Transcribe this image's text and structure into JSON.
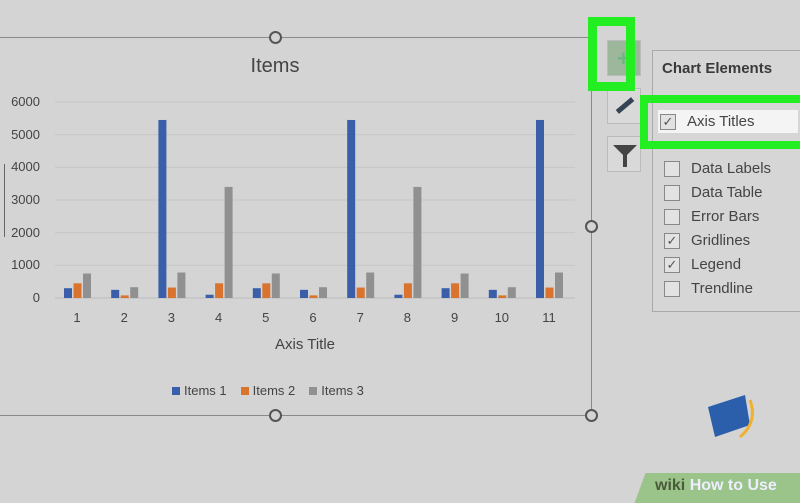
{
  "chart_data": {
    "type": "bar",
    "title": "Items",
    "xlabel": "Axis Title",
    "ylabel": "",
    "categories": [
      "1",
      "2",
      "3",
      "4",
      "5",
      "6",
      "7",
      "8",
      "9",
      "10",
      "11"
    ],
    "ylim": [
      0,
      6000
    ],
    "yticks": [
      "0",
      "1000",
      "2000",
      "3000",
      "4000",
      "5000",
      "6000"
    ],
    "grid": true,
    "legend_position": "bottom",
    "series": [
      {
        "name": "Items 1",
        "color": "#3a5ea8",
        "values": [
          300,
          250,
          5450,
          100,
          300,
          250,
          5450,
          100,
          300,
          250,
          5450
        ]
      },
      {
        "name": "Items 2",
        "color": "#d9732e",
        "values": [
          450,
          80,
          320,
          450,
          450,
          80,
          320,
          450,
          450,
          80,
          320
        ]
      },
      {
        "name": "Items 3",
        "color": "#909090",
        "values": [
          750,
          330,
          780,
          3400,
          750,
          330,
          780,
          3400,
          750,
          330,
          780
        ]
      }
    ]
  },
  "panel": {
    "title": "Chart Elements",
    "items": [
      {
        "label": "Axis Titles",
        "checked": true
      },
      {
        "label": "Data Labels",
        "checked": false
      },
      {
        "label": "Data Table",
        "checked": false
      },
      {
        "label": "Error Bars",
        "checked": false
      },
      {
        "label": "Gridlines",
        "checked": true
      },
      {
        "label": "Legend",
        "checked": true
      },
      {
        "label": "Trendline",
        "checked": false
      }
    ]
  },
  "side_buttons": [
    "plus-icon",
    "brush-icon",
    "filter-icon"
  ],
  "highlight_color": "#22ee22",
  "watermark": {
    "wiki": "wiki",
    "text": "How to Use"
  },
  "check_mark": "✓"
}
